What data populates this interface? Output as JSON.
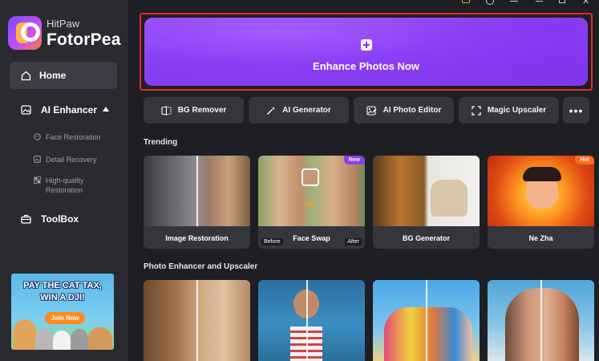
{
  "app": {
    "brand": "HitPaw",
    "name": "FotorPea"
  },
  "sidebar": {
    "home": "Home",
    "ai_enhancer": "AI Enhancer",
    "sub_items": [
      "Face Restoration",
      "Detail Recovery",
      "High-quality",
      "Restoration"
    ],
    "toolbox": "ToolBox"
  },
  "promo": {
    "line1": "PAY THE CAT TAX,",
    "line2": "WIN A DJI!",
    "button": "Join Now"
  },
  "hero": {
    "label": "Enhance Photos Now"
  },
  "tools": [
    "BG Remover",
    "AI Generator",
    "AI Photo Editor",
    "Magic Upscaler"
  ],
  "trending": {
    "title": "Trending",
    "cards": [
      "Image Restoration",
      "Face Swap",
      "BG Generator",
      "Ne Zha"
    ],
    "badge_new": "New",
    "badge_hot": "Hot",
    "before": "Before",
    "after": "After"
  },
  "enhancer": {
    "title": "Photo Enhancer and Upscaler"
  },
  "colors": {
    "accent": "#8a3df5",
    "highlight_border": "#e02a2a",
    "sidebar_bg": "#2a2b31",
    "app_bg": "#1e1f24"
  }
}
